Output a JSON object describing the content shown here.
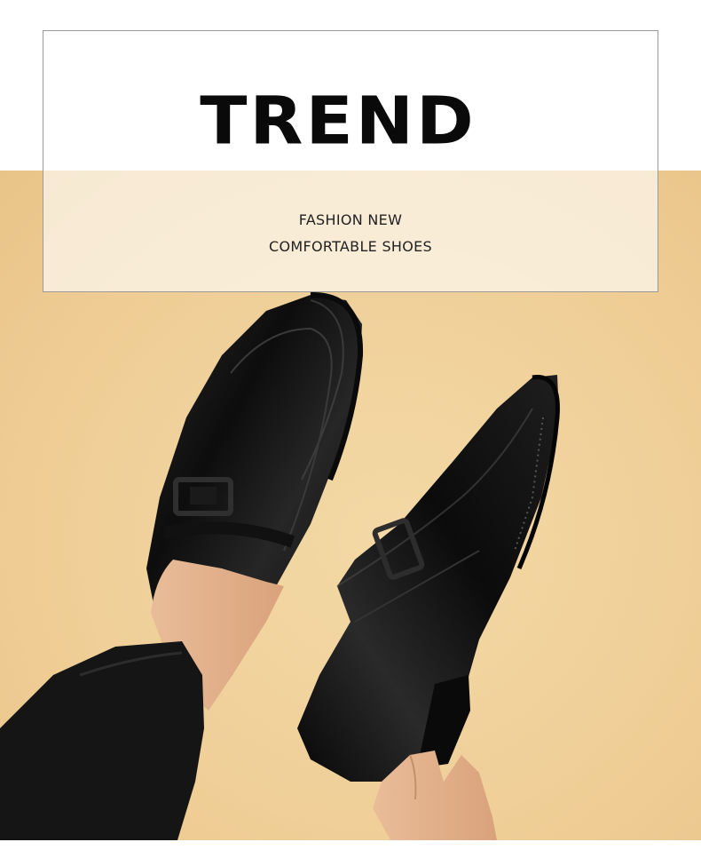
{
  "banner": {
    "title": "TREND",
    "subtitle_line1": "FASHION NEW",
    "subtitle_line2": "COMFORTABLE SHOES"
  },
  "colors": {
    "background_top": "#ffffff",
    "backdrop": "#f0cf98",
    "shoe": "#0d0d0d",
    "trousers": "#141414",
    "skin": "#e8b892",
    "frame_border": "#9a9a9a"
  },
  "photo": {
    "subject": "two black leather loafers with metal horsebit buckle, one worn on foot, one held in hand"
  }
}
